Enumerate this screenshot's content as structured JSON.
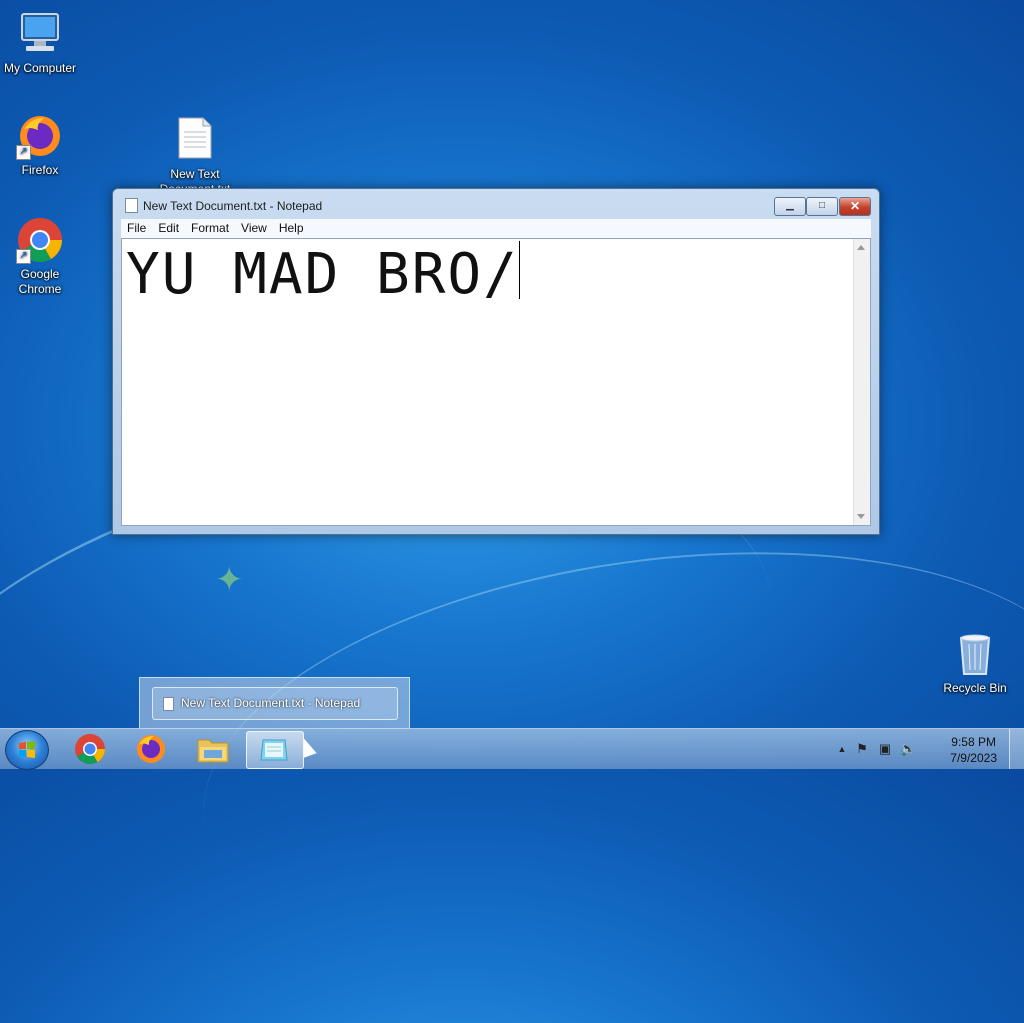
{
  "desktop": {
    "icons": [
      {
        "label": "My Computer"
      },
      {
        "label": "Firefox"
      },
      {
        "label": "New Text Document.txt"
      },
      {
        "label": "Google Chrome"
      },
      {
        "label": "Recycle Bin"
      }
    ]
  },
  "notepad": {
    "title": "New Text Document.txt - Notepad",
    "menu": [
      "File",
      "Edit",
      "Format",
      "View",
      "Help"
    ],
    "content": "YU MAD BRO/",
    "buttons": {
      "minimize": "▁",
      "maximize": "□",
      "close": "✕"
    }
  },
  "taskbar": {
    "thumbnail_title": "New Text Document.txt - Notepad",
    "pinned": [
      "start-button",
      "chrome-icon",
      "firefox-icon",
      "explorer-icon",
      "notepad-icon"
    ],
    "clock_time": "9:58 PM",
    "clock_date": "7/9/2023"
  },
  "colors": {
    "accent": "#1877cf",
    "close": "#c4412b"
  }
}
